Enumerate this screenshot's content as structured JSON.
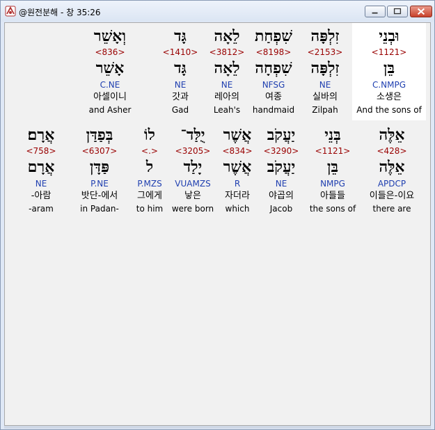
{
  "window": {
    "title": "@원전분해 - 창 35:26",
    "accent": "#c8412b"
  },
  "row1": [
    {
      "heb": "וּבְנֵי",
      "strong": "<1121>",
      "lemma": "בֵּן",
      "parse": "C.NMPG",
      "kor": "소생은",
      "eng": "And the sons of"
    },
    {
      "heb": "זִלְפָּה",
      "strong": "<2153>",
      "lemma": "זִלְפָּה",
      "parse": "NE",
      "kor": "실바의",
      "eng": "Zilpah"
    },
    {
      "heb": "שִׁפְחַת",
      "strong": "<8198>",
      "lemma": "שִׁפְחָה",
      "parse": "NFSG",
      "kor": "여종",
      "eng": "handmaid"
    },
    {
      "heb": "לֵאָה",
      "strong": "<3812>",
      "lemma": "לֵאָה",
      "parse": "NE",
      "kor": "레아의",
      "eng": "Leah's"
    },
    {
      "heb": "גָּד",
      "strong": "<1410>",
      "lemma": "גָּד",
      "parse": "NE",
      "kor": "갓과",
      "eng": "Gad"
    },
    {
      "heb": "וְאָשֵׁר",
      "strong": "<836>",
      "lemma": "אָשֵׁר",
      "parse": "C.NE",
      "kor": "아셀이니",
      "eng": "and Asher"
    }
  ],
  "row2": [
    {
      "heb": "אֵלֶּה",
      "strong": "<428>",
      "lemma": "אֵלֶּה",
      "parse": "APDCP",
      "kor": "이들은-이요",
      "eng": "there are"
    },
    {
      "heb": "בְּנֵי",
      "strong": "<1121>",
      "lemma": "בֵּן",
      "parse": "NMPG",
      "kor": "아들들",
      "eng": "the sons of"
    },
    {
      "heb": "יַעֲקֹב",
      "strong": "<3290>",
      "lemma": "יַעֲקֹב",
      "parse": "NE",
      "kor": "야곱의",
      "eng": "Jacob"
    },
    {
      "heb": "אֲשֶׁר",
      "strong": "<834>",
      "lemma": "אֲשֶׁר",
      "parse": "R",
      "kor": "자더라",
      "eng": "which"
    },
    {
      "heb": "יֻלַּד־",
      "strong": "<3205>",
      "lemma": "יָלַד",
      "parse": "VUAMZS",
      "kor": "낳은",
      "eng": "were born"
    },
    {
      "heb": "לוֹ",
      "strong": "<.>",
      "lemma": "ל",
      "parse": "P.MZS",
      "kor": "그에게",
      "eng": "to him"
    },
    {
      "heb": "בְּפַדַּן",
      "strong": "<6307>",
      "lemma": "פַּדָּן",
      "parse": "P.NE",
      "kor": "밧단-에서",
      "eng": "in Padan-"
    },
    {
      "heb": "אֲרָם׃",
      "strong": "<758>",
      "lemma": "אֲרָם",
      "parse": "NE",
      "kor": "-아람",
      "eng": "-aram"
    }
  ]
}
